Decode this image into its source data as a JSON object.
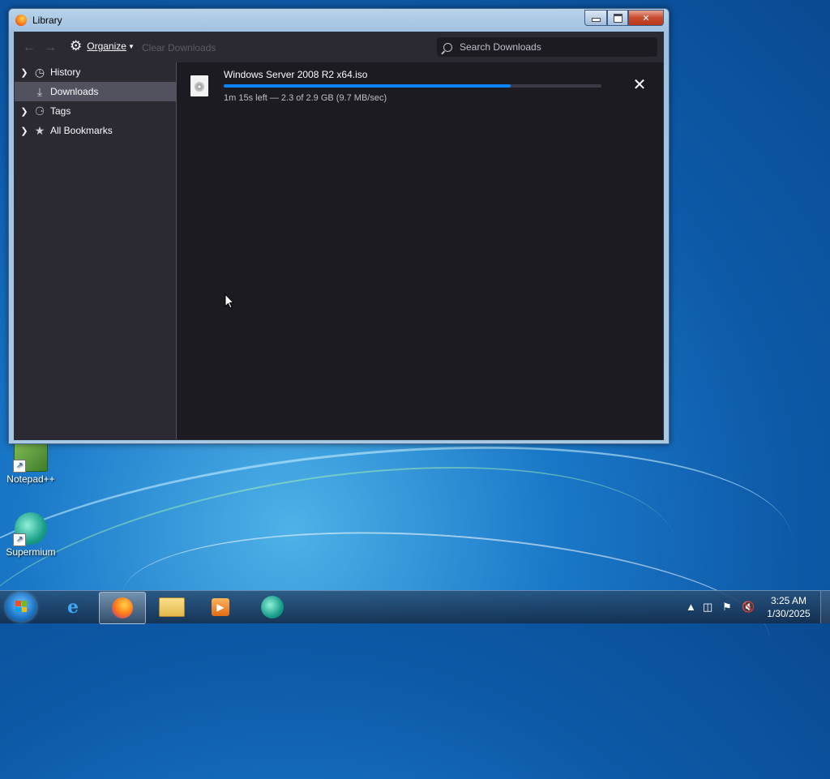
{
  "window": {
    "title": "Library",
    "caption_buttons": [
      "minimize",
      "maximize",
      "close"
    ]
  },
  "toolbar": {
    "organize_label": "Organize",
    "clear_label": "Clear Downloads",
    "search_placeholder": "Search Downloads"
  },
  "sidebar": {
    "items": [
      {
        "label": "History",
        "icon": "clock-icon",
        "expandable": true,
        "selected": false
      },
      {
        "label": "Downloads",
        "icon": "download-icon",
        "expandable": false,
        "selected": true
      },
      {
        "label": "Tags",
        "icon": "tag-icon",
        "expandable": true,
        "selected": false
      },
      {
        "label": "All Bookmarks",
        "icon": "star-icon",
        "expandable": true,
        "selected": false
      }
    ]
  },
  "downloads": [
    {
      "name": "Windows Server 2008 R2 x64.iso",
      "status": "1m 15s left — 2.3 of 2.9 GB (9.7 MB/sec)",
      "progress_fraction": 0.76
    }
  ],
  "desktop": {
    "icons": [
      {
        "label": "Notepad++"
      },
      {
        "label": "Supermium"
      }
    ]
  },
  "taskbar": {
    "apps": [
      "internet-explorer-icon",
      "firefox-icon",
      "file-explorer-icon",
      "media-player-icon",
      "supermium-icon"
    ],
    "active_app": "firefox-icon",
    "clock_time": "3:25 AM",
    "clock_date": "1/30/2025"
  },
  "colors": {
    "accent": "#0a84ff",
    "panel": "#2b2a33",
    "background": "#1c1b22",
    "selected": "#52525e"
  }
}
